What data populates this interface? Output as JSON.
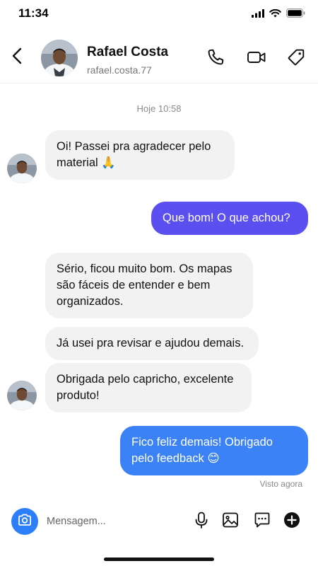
{
  "status_bar": {
    "time": "11:34",
    "icons": [
      "signal-icon",
      "wifi-icon",
      "battery-icon"
    ]
  },
  "header": {
    "back_icon": "chevron-left-icon",
    "contact_name": "Rafael Costa",
    "contact_handle": "rafael.costa.77",
    "actions": [
      "phone-icon",
      "video-icon",
      "tag-icon"
    ]
  },
  "chat": {
    "date_divider": "Hoje 10:58",
    "messages": [
      {
        "direction": "incoming",
        "text": "Oi! Passei pra agradecer pelo material 🙏"
      },
      {
        "direction": "outgoing",
        "text": "Que bom! O que achou?"
      },
      {
        "direction": "incoming",
        "text": "Sério, ficou muito bom. Os mapas são fáceis de entender e bem organizados."
      },
      {
        "direction": "incoming",
        "text": "Já usei pra revisar e ajudou demais."
      },
      {
        "direction": "incoming",
        "text": "Obrigada pelo capricho, excelente produto!"
      },
      {
        "direction": "outgoing",
        "text": "Fico feliz demais! Obrigado pelo feedback 😊"
      }
    ],
    "seen_status": "Visto agora"
  },
  "composer": {
    "placeholder": "Mensagem...",
    "value": "",
    "icons": [
      "camera-icon",
      "microphone-icon",
      "image-icon",
      "sticker-icon",
      "plus-icon"
    ]
  },
  "colors": {
    "outgoing_purple": "#5b4ff0",
    "outgoing_blue": "#3b82f6",
    "incoming_bubble": "#f2f2f2",
    "camera_button": "#2d7ff9"
  }
}
